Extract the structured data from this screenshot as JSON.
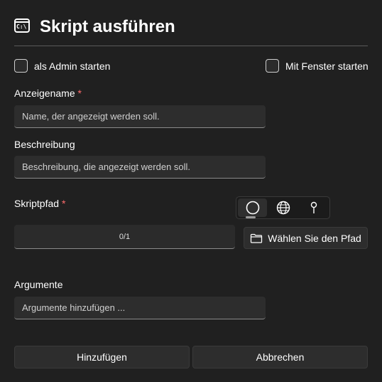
{
  "header": {
    "title": "Skript ausführen",
    "icon": "terminal-icon",
    "icon_text": "C:\\"
  },
  "options": {
    "admin_label": "als Admin starten",
    "admin_checked": false,
    "window_label": "Mit Fenster starten",
    "window_checked": false
  },
  "display_name": {
    "label": "Anzeigename",
    "required_mark": "*",
    "placeholder": "Name, der angezeigt werden soll."
  },
  "description": {
    "label": "Beschreibung",
    "placeholder": "Beschreibung, die angezeigt werden soll."
  },
  "script_path": {
    "label": "Skriptpfad",
    "required_mark": "*",
    "source_options": [
      {
        "icon": "circle-icon",
        "selected": true
      },
      {
        "icon": "globe-icon",
        "selected": false
      },
      {
        "icon": "pin-icon",
        "selected": false
      }
    ],
    "progress_text": "0/1",
    "browse_label": "Wählen Sie den Pfad",
    "browse_icon": "folder-icon"
  },
  "arguments": {
    "label": "Argumente",
    "placeholder": "Argumente hinzufügen ..."
  },
  "footer": {
    "add_label": "Hinzufügen",
    "cancel_label": "Abbrechen"
  },
  "colors": {
    "background": "#202020",
    "required": "#ff6b6b",
    "input_bg": "#2d2d2d"
  }
}
